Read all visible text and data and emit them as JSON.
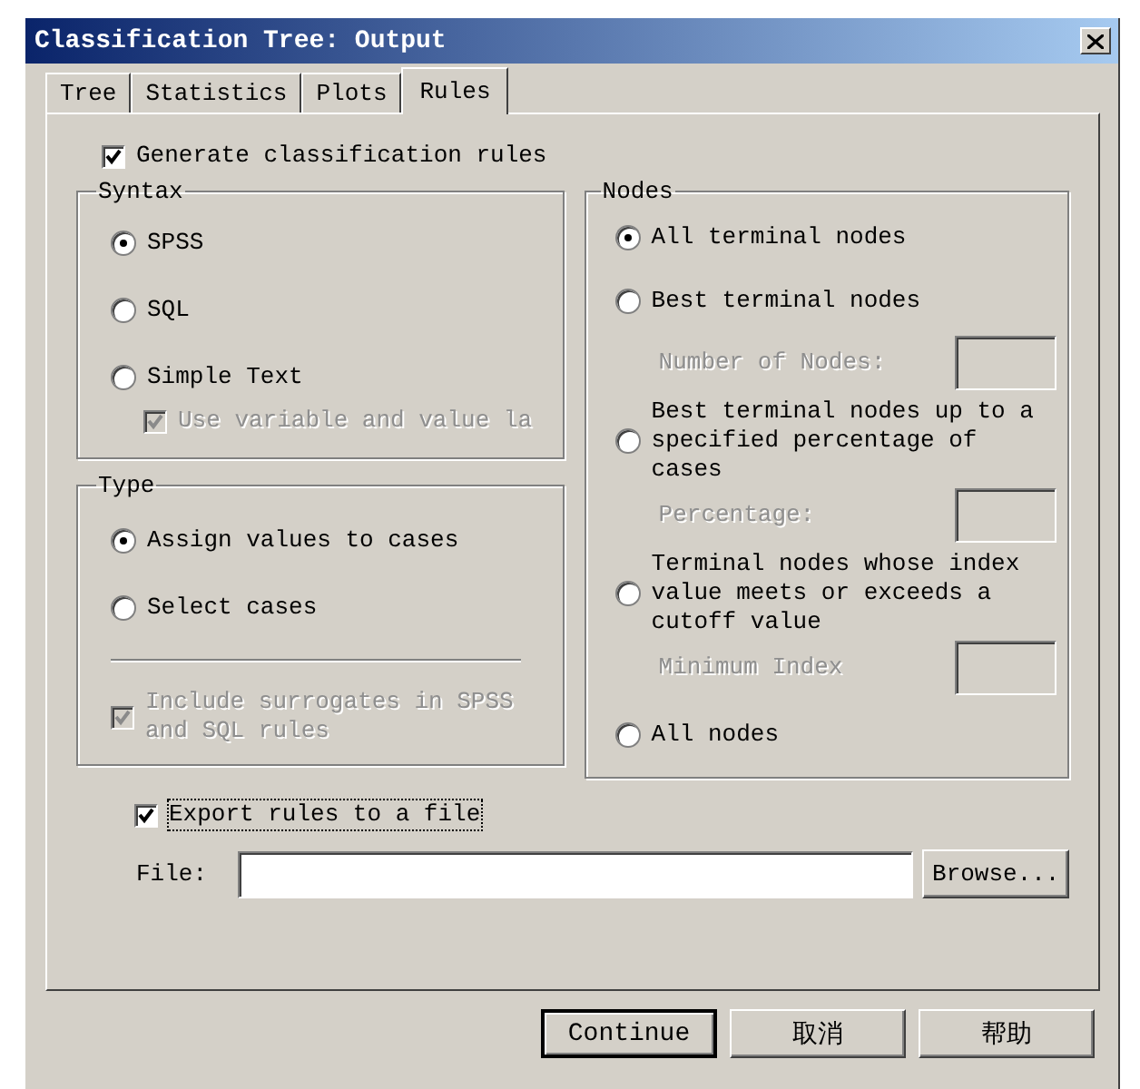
{
  "window": {
    "title": "Classification Tree: Output"
  },
  "tabs": [
    {
      "label": "Tree",
      "selected": false
    },
    {
      "label": "Statistics",
      "selected": false
    },
    {
      "label": "Plots",
      "selected": false
    },
    {
      "label": "Rules",
      "selected": true
    }
  ],
  "generate_rules": {
    "label": "Generate classification rules",
    "checked": true
  },
  "syntax": {
    "title": "Syntax",
    "options": [
      {
        "label": "SPSS",
        "selected": true
      },
      {
        "label": "SQL",
        "selected": false
      },
      {
        "label": "Simple Text",
        "selected": false
      }
    ],
    "use_labels": {
      "label": "Use variable and value la",
      "checked": true,
      "disabled": true
    }
  },
  "type": {
    "title": "Type",
    "options": [
      {
        "label": "Assign values to cases",
        "selected": true
      },
      {
        "label": "Select cases",
        "selected": false
      }
    ],
    "include_surrogates": {
      "label": "Include surrogates in SPSS and SQL rules",
      "checked": true,
      "disabled": true
    }
  },
  "nodes": {
    "title": "Nodes",
    "options": [
      {
        "label": "All terminal nodes",
        "selected": true
      },
      {
        "label": "Best terminal nodes",
        "selected": false,
        "field": {
          "label": "Number of Nodes:",
          "disabled": true
        }
      },
      {
        "label": "Best terminal nodes up to a specified percentage of cases",
        "selected": false,
        "field": {
          "label": "Percentage:",
          "disabled": true
        }
      },
      {
        "label": "Terminal nodes whose index value meets or exceeds a cutoff value",
        "selected": false,
        "field": {
          "label": "Minimum Index",
          "disabled": true
        }
      },
      {
        "label": "All nodes",
        "selected": false
      }
    ]
  },
  "export_rules": {
    "label": "Export rules to a file",
    "checked": true
  },
  "file": {
    "label": "File:",
    "browse": "Browse..."
  },
  "buttons": [
    {
      "label": "Continue",
      "default": true
    },
    {
      "label": "取消",
      "default": false
    },
    {
      "label": "帮助",
      "default": false
    }
  ]
}
